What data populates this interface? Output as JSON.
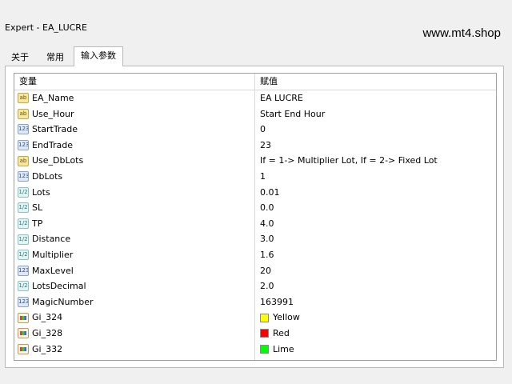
{
  "window": {
    "title": "Expert - EA_LUCRE",
    "watermark": "www.mt4.shop"
  },
  "tabs": [
    {
      "label": "关于",
      "active": false
    },
    {
      "label": "常用",
      "active": false
    },
    {
      "label": "输入参数",
      "active": true
    }
  ],
  "grid": {
    "columns": {
      "name": "变量",
      "value": "赋值"
    },
    "rows": [
      {
        "type": "string",
        "icon": "ab",
        "name": "EA_Name",
        "value": "EA LUCRE"
      },
      {
        "type": "string",
        "icon": "ab",
        "name": "Use_Hour",
        "value": "Start End Hour"
      },
      {
        "type": "int",
        "icon": "123",
        "name": "StartTrade",
        "value": "0"
      },
      {
        "type": "int",
        "icon": "123",
        "name": "EndTrade",
        "value": "23"
      },
      {
        "type": "string",
        "icon": "ab",
        "name": "Use_DbLots",
        "value": "If = 1-> Multiplier Lot, If = 2-> Fixed Lot"
      },
      {
        "type": "int",
        "icon": "123",
        "name": "DbLots",
        "value": "1"
      },
      {
        "type": "double",
        "icon": "1/2",
        "name": "Lots",
        "value": "0.01"
      },
      {
        "type": "double",
        "icon": "1/2",
        "name": "SL",
        "value": "0.0"
      },
      {
        "type": "double",
        "icon": "1/2",
        "name": "TP",
        "value": "4.0"
      },
      {
        "type": "double",
        "icon": "1/2",
        "name": "Distance",
        "value": "3.0"
      },
      {
        "type": "double",
        "icon": "1/2",
        "name": "Multiplier",
        "value": "1.6"
      },
      {
        "type": "int",
        "icon": "123",
        "name": "MaxLevel",
        "value": "20"
      },
      {
        "type": "double",
        "icon": "1/2",
        "name": "LotsDecimal",
        "value": "2.0"
      },
      {
        "type": "int",
        "icon": "123",
        "name": "MagicNumber",
        "value": "163991"
      },
      {
        "type": "color",
        "icon": "palette-icon",
        "name": "Gi_324",
        "value": "Yellow",
        "swatch": "#ffff00"
      },
      {
        "type": "color",
        "icon": "palette-icon",
        "name": "Gi_328",
        "value": "Red",
        "swatch": "#ff0000"
      },
      {
        "type": "color",
        "icon": "palette-icon",
        "name": "Gi_332",
        "value": "Lime",
        "swatch": "#00ff00"
      }
    ]
  }
}
